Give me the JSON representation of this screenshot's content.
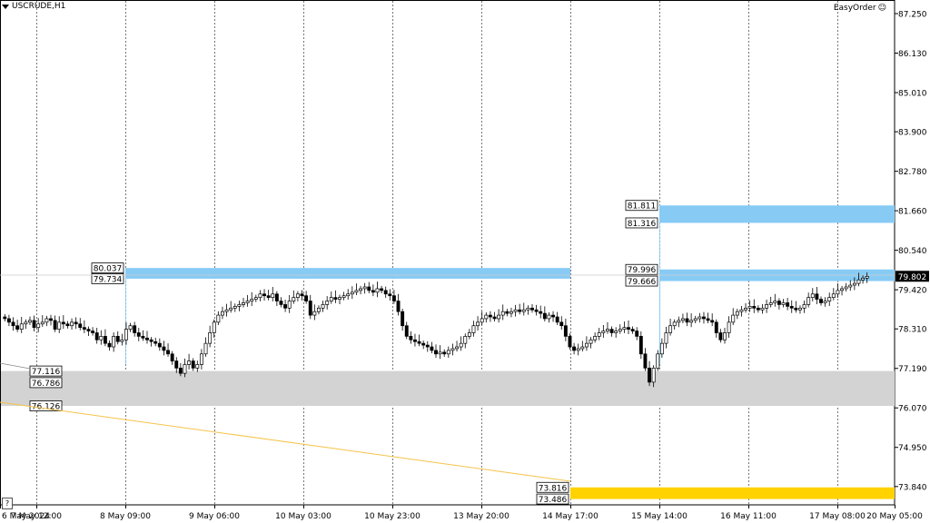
{
  "header": {
    "symbol": "USCRUDE,H1",
    "expert": "EasyOrder",
    "expert_icon": "smiley-icon"
  },
  "help_label": "?",
  "colors": {
    "zone_blue": "#87CBF5",
    "zone_gray": "#D3D3D3",
    "zone_gold": "#FFD200",
    "trendline": "#F5C34A",
    "bull": "#ffffff",
    "bear": "#000000"
  },
  "chart_data": {
    "type": "candlestick",
    "symbol": "USCRUDE",
    "timeframe": "H1",
    "ylim": [
      72.7,
      87.8
    ],
    "y_ticks": [
      "87.250",
      "86.130",
      "85.010",
      "83.900",
      "82.780",
      "81.660",
      "80.540",
      "79.420",
      "78.310",
      "77.190",
      "76.070",
      "74.950",
      "73.840"
    ],
    "x_ticks": [
      "6 May 2024",
      "7 May 12:00",
      "8 May 09:00",
      "9 May 06:00",
      "10 May 03:00",
      "10 May 23:00",
      "13 May 20:00",
      "14 May 17:00",
      "15 May 14:00",
      "16 May 11:00",
      "17 May 08:00",
      "20 May 05:00"
    ],
    "current_price": "79.802",
    "close_series": [
      78.6,
      78.5,
      78.4,
      78.3,
      78.45,
      78.5,
      78.55,
      78.35,
      78.45,
      78.5,
      78.6,
      78.55,
      78.3,
      78.5,
      78.45,
      78.4,
      78.5,
      78.45,
      78.35,
      78.3,
      78.25,
      78.2,
      78.0,
      78.1,
      77.9,
      77.8,
      78.1,
      77.95,
      78.0,
      78.3,
      78.4,
      78.2,
      78.1,
      78.05,
      78.0,
      77.95,
      77.9,
      77.8,
      77.7,
      77.6,
      77.4,
      77.2,
      77.05,
      77.3,
      77.4,
      77.2,
      77.3,
      77.6,
      77.9,
      78.2,
      78.5,
      78.7,
      78.8,
      78.85,
      78.9,
      78.95,
      79.0,
      79.05,
      79.1,
      79.15,
      79.2,
      79.3,
      79.25,
      79.2,
      79.3,
      79.1,
      79.0,
      78.9,
      79.1,
      79.2,
      79.3,
      79.25,
      79.1,
      78.7,
      78.8,
      78.9,
      79.0,
      79.1,
      79.2,
      79.15,
      79.2,
      79.25,
      79.3,
      79.35,
      79.4,
      79.45,
      79.5,
      79.4,
      79.35,
      79.45,
      79.4,
      79.3,
      79.25,
      79.1,
      78.8,
      78.4,
      78.1,
      78.0,
      77.95,
      77.9,
      77.85,
      77.8,
      77.7,
      77.6,
      77.65,
      77.6,
      77.7,
      77.75,
      77.8,
      77.9,
      78.1,
      78.2,
      78.4,
      78.5,
      78.6,
      78.7,
      78.65,
      78.6,
      78.7,
      78.8,
      78.75,
      78.8,
      78.85,
      78.8,
      78.85,
      78.9,
      78.85,
      78.8,
      78.75,
      78.6,
      78.7,
      78.65,
      78.5,
      78.4,
      78.1,
      77.8,
      77.7,
      77.75,
      77.8,
      77.9,
      78.0,
      78.1,
      78.2,
      78.25,
      78.3,
      78.2,
      78.25,
      78.3,
      78.35,
      78.3,
      78.25,
      78.1,
      77.6,
      77.2,
      76.8,
      77.2,
      77.6,
      77.9,
      78.2,
      78.4,
      78.5,
      78.55,
      78.6,
      78.5,
      78.55,
      78.6,
      78.65,
      78.6,
      78.55,
      78.5,
      78.2,
      78.0,
      78.2,
      78.5,
      78.7,
      78.8,
      78.85,
      78.9,
      78.95,
      78.9,
      78.85,
      78.9,
      79.0,
      79.05,
      79.1,
      79.0,
      79.05,
      78.95,
      78.9,
      78.85,
      78.9,
      79.0,
      79.2,
      79.3,
      79.15,
      79.05,
      79.1,
      79.2,
      79.3,
      79.4,
      79.45,
      79.5,
      79.55,
      79.6,
      79.7,
      79.75,
      79.8
    ],
    "zones": [
      {
        "kind": "resistance",
        "color": "blue",
        "from_tick": "8 May 09:00",
        "to_tick": "14 May 17:00",
        "top": "80.037",
        "bottom": "79.734"
      },
      {
        "kind": "resistance",
        "color": "blue",
        "from_tick": "15 May 14:00",
        "to_tick": "right_edge",
        "top": "81.811",
        "bottom": "81.316"
      },
      {
        "kind": "resistance",
        "color": "blue",
        "from_tick": "15 May 14:00",
        "to_tick": "right_edge",
        "top": "79.996",
        "bottom": "79.666"
      },
      {
        "kind": "support",
        "color": "gray",
        "from_tick": "left_edge",
        "to_tick": "right_edge",
        "top": "77.116",
        "bottom": "76.126",
        "mid": "76.786"
      },
      {
        "kind": "support",
        "color": "gold",
        "from_tick": "14 May 17:00",
        "to_tick": "right_edge",
        "top": "73.816",
        "bottom": "73.486"
      }
    ]
  }
}
